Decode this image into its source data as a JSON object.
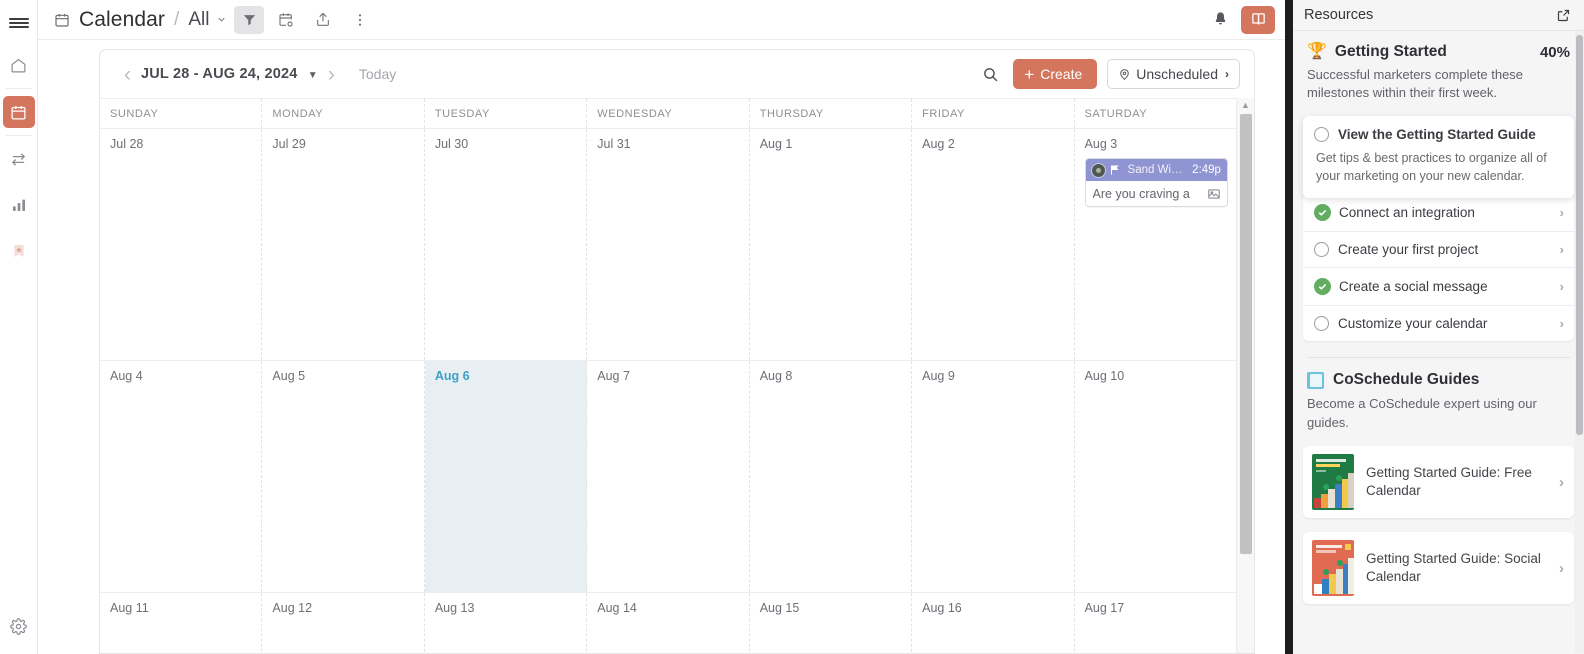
{
  "rail": {
    "menu_icon": "hamburger-menu-icon",
    "items": [
      {
        "name": "home",
        "icon": "home-icon",
        "active": false
      },
      {
        "name": "calendar",
        "icon": "calendar-icon",
        "active": true
      },
      {
        "name": "workflow",
        "icon": "shuffle-icon",
        "active": false
      },
      {
        "name": "analytics",
        "icon": "bar-chart-icon",
        "active": false
      },
      {
        "name": "bookmarks",
        "icon": "star-bookmark-icon",
        "active": false
      }
    ],
    "settings": {
      "name": "settings",
      "icon": "gear-icon"
    }
  },
  "topbar": {
    "calendar_icon": "calendar-icon",
    "title": "Calendar",
    "separator": "/",
    "scope": "All",
    "scope_caret": "chevron-down-icon",
    "filter_icon": "filter-icon",
    "add_calendar_icon": "calendar-settings-icon",
    "share_icon": "share-icon",
    "more_icon": "kebab-menu-icon",
    "bell_icon": "bell-icon",
    "book_icon": "book-icon"
  },
  "calendar_toolbar": {
    "prev_label": "‹",
    "next_label": "›",
    "date_range": "JUL 28 - AUG 24, 2024",
    "date_caret": "chevron-down-icon",
    "today_label": "Today",
    "search_icon": "search-icon",
    "create_label": "Create",
    "create_plus": "+",
    "create_color": "#d4755e",
    "unscheduled_label": "Unscheduled",
    "unscheduled_pin": "pin-icon",
    "unscheduled_chev": "›"
  },
  "calendar": {
    "day_headers": [
      "SUNDAY",
      "MONDAY",
      "TUESDAY",
      "WEDNESDAY",
      "THURSDAY",
      "FRIDAY",
      "SATURDAY"
    ],
    "today_color": "#3f9fc4",
    "today_bg": "#e7eff3",
    "weeks": [
      {
        "days": [
          {
            "label": "Jul 28",
            "today": false
          },
          {
            "label": "Jul 29",
            "today": false
          },
          {
            "label": "Jul 30",
            "today": false
          },
          {
            "label": "Jul 31",
            "today": false
          },
          {
            "label": "Aug 1",
            "today": false
          },
          {
            "label": "Aug 2",
            "today": false
          },
          {
            "label": "Aug 3",
            "today": false
          }
        ]
      },
      {
        "days": [
          {
            "label": "Aug 4",
            "today": false
          },
          {
            "label": "Aug 5",
            "today": false
          },
          {
            "label": "Aug 6",
            "today": true
          },
          {
            "label": "Aug 7",
            "today": false
          },
          {
            "label": "Aug 8",
            "today": false
          },
          {
            "label": "Aug 9",
            "today": false
          },
          {
            "label": "Aug 10",
            "today": false
          }
        ]
      },
      {
        "days": [
          {
            "label": "Aug 11",
            "today": false
          },
          {
            "label": "Aug 12",
            "today": false
          },
          {
            "label": "Aug 13",
            "today": false
          },
          {
            "label": "Aug 14",
            "today": false
          },
          {
            "label": "Aug 15",
            "today": false
          },
          {
            "label": "Aug 16",
            "today": false
          },
          {
            "label": "Aug 17",
            "today": false
          }
        ]
      }
    ],
    "event": {
      "day_index": 6,
      "week_index": 0,
      "avatar_icon": "user-avatar-icon",
      "flag_icon": "flag-icon",
      "title": "Sand Wi…",
      "time": "2:49p",
      "body_text": "Are you craving a",
      "body_icon": "image-icon",
      "header_color": "#8f94d2"
    }
  },
  "resources": {
    "title": "Resources",
    "external_icon": "external-link-icon",
    "getting_started": {
      "trophy_icon": "trophy-icon",
      "title": "Getting Started",
      "percent": "40%",
      "description": "Successful marketers complete these milestones within their first week.",
      "items": [
        {
          "label": "View the Getting Started Guide",
          "done": false,
          "expanded": true,
          "description": "Get tips & best practices to organize all of your marketing on your new calendar."
        },
        {
          "label": "Connect an integration",
          "done": true,
          "expanded": false,
          "description": ""
        },
        {
          "label": "Create your first project",
          "done": false,
          "expanded": false,
          "description": ""
        },
        {
          "label": "Create a social message",
          "done": true,
          "expanded": false,
          "description": ""
        },
        {
          "label": "Customize your calendar",
          "done": false,
          "expanded": false,
          "description": ""
        }
      ]
    },
    "guides": {
      "icon": "book-icon",
      "title": "CoSchedule Guides",
      "description": "Become a CoSchedule expert using our guides.",
      "cards": [
        {
          "label": "Getting Started Guide: Free Calendar",
          "thumb_color": "#1f7a44",
          "chevron": "›"
        },
        {
          "label": "Getting Started Guide: Social Calendar",
          "thumb_color": "#e06a52",
          "chevron": "›"
        }
      ]
    }
  }
}
